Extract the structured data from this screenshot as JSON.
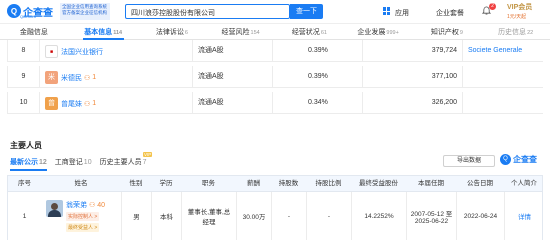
{
  "header": {
    "logo_char": "Q",
    "logo_text": "企查查",
    "logo_sub": "Qcc.com",
    "slogan": "全国企业信用查询系统 官方备案企业征信机构",
    "search_value": "四川浪莎控股股份有限公司",
    "search_button": "查一下",
    "app_label": "应用",
    "enterprise_label": "企业套餐",
    "notif_count": "2",
    "vip_label": "VIP会员",
    "vip_sub": "1元/天起"
  },
  "tabs": [
    {
      "label": "金融信息",
      "count": ""
    },
    {
      "label": "基本信息",
      "count": "114"
    },
    {
      "label": "法律诉讼",
      "count": "6"
    },
    {
      "label": "经营风险",
      "count": "154"
    },
    {
      "label": "经营状况",
      "count": "61"
    },
    {
      "label": "企业发展",
      "count": "999+"
    },
    {
      "label": "知识产权",
      "count": "9"
    },
    {
      "label": "历史信息",
      "count": "22"
    }
  ],
  "shareholders": [
    {
      "num": "8",
      "avatar_char": "",
      "avatar_color": "#ffffff",
      "name": "法国兴业银行",
      "count": "",
      "share_type": "流通A股",
      "percent": "0.39%",
      "shares": "379,724",
      "extra": "Societe Generale"
    },
    {
      "num": "9",
      "avatar_char": "米",
      "avatar_color": "#f2a37b",
      "name": "米德民",
      "count": "1",
      "share_type": "流通A股",
      "percent": "0.39%",
      "shares": "377,100",
      "extra": ""
    },
    {
      "num": "10",
      "avatar_char": "曾",
      "avatar_color": "#f0a14b",
      "name": "曾尾妹",
      "count": "1",
      "share_type": "流通A股",
      "percent": "0.34%",
      "shares": "326,200",
      "extra": ""
    }
  ],
  "section": {
    "title": "主要人员",
    "subtabs": [
      {
        "label": "最新公示",
        "count": "12"
      },
      {
        "label": "工商登记",
        "count": "10"
      },
      {
        "label": "历史主要人员",
        "count": "7"
      }
    ],
    "vip_tag": "VIP",
    "export_label": "导出数据",
    "qcc_char": "Q",
    "qcc_text": "企查查"
  },
  "table": {
    "headers": [
      "序号",
      "姓名",
      "性别",
      "学历",
      "职务",
      "薪酬",
      "持股数",
      "持股比例",
      "最终受益股份",
      "本届任期",
      "公告日期",
      "个人简介"
    ],
    "rows": [
      {
        "num": "1",
        "name": "翁荣弟",
        "count": "40",
        "tag1": "实际控制人 >",
        "tag2": "最终受益人 >",
        "gender": "男",
        "edu": "本科",
        "position": "董事长,董事,总经理",
        "salary": "30.00万",
        "shares": "-",
        "ratio": "-",
        "benefit": "14.2252%",
        "term": "2007-05-12 至 2025-06-22",
        "date": "2022-06-24",
        "profile": "详情"
      }
    ]
  }
}
